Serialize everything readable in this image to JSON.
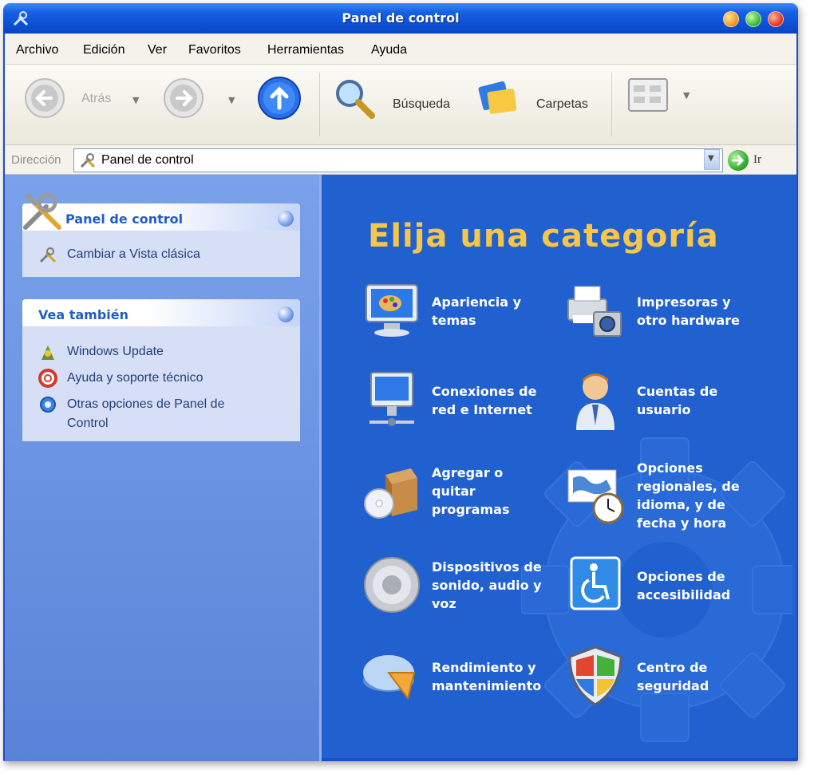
{
  "window": {
    "title": "Panel de control"
  },
  "menu": [
    "Archivo",
    "Edición",
    "Ver",
    "Favoritos",
    "Herramientas",
    "Ayuda"
  ],
  "toolbar": {
    "back_label": "Atrás",
    "search_label": "Búsqueda",
    "folders_label": "Carpetas"
  },
  "address": {
    "label": "Dirección",
    "value": "Panel de control",
    "go_label": "Ir"
  },
  "sidebar": {
    "panel_box": {
      "title": "Panel de control",
      "link": "Cambiar a Vista clásica"
    },
    "see_also_box": {
      "title": "Vea también",
      "links": [
        "Windows Update",
        "Ayuda y soporte técnico",
        "Otras opciones de Panel de\nControl"
      ]
    }
  },
  "main": {
    "heading": "Elija una categoría",
    "categories": [
      {
        "label": "Apariencia y\ntemas",
        "icon": "monitor-paint-icon"
      },
      {
        "label": "Impresoras y\notro hardware",
        "icon": "printer-camera-icon"
      },
      {
        "label": "Conexiones de\nred e Internet",
        "icon": "network-monitor-icon"
      },
      {
        "label": "Cuentas de\nusuario",
        "icon": "user-account-icon"
      },
      {
        "label": "Agregar o\nquitar\nprogramas",
        "icon": "box-cd-icon"
      },
      {
        "label": "Opciones\nregionales, de\nidioma, y de\nfecha y hora",
        "icon": "globe-clock-icon"
      },
      {
        "label": "Dispositivos de\nsonido, audio y\nvoz",
        "icon": "speaker-icon"
      },
      {
        "label": "Opciones de\naccesibilidad",
        "icon": "accessibility-icon"
      },
      {
        "label": "Rendimiento y\nmantenimiento",
        "icon": "performance-pie-icon"
      },
      {
        "label": "Centro de\nseguridad",
        "icon": "security-shield-icon"
      }
    ]
  }
}
